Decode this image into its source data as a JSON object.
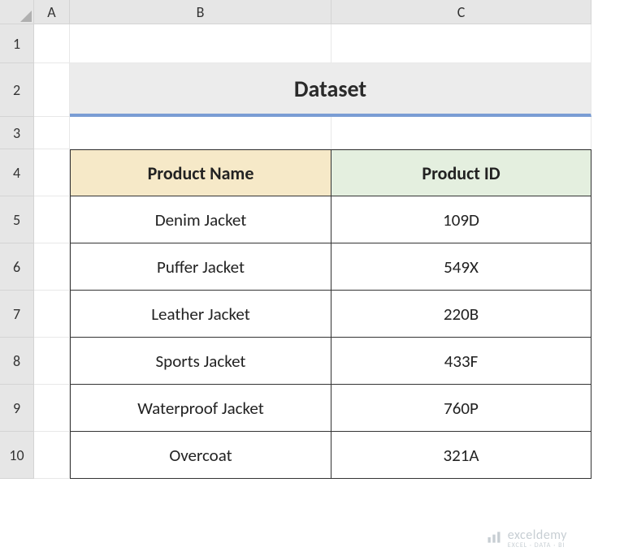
{
  "columns": [
    "A",
    "B",
    "C"
  ],
  "rows": [
    "1",
    "2",
    "3",
    "4",
    "5",
    "6",
    "7",
    "8",
    "9",
    "10"
  ],
  "title": "Dataset",
  "headers": {
    "b": "Product Name",
    "c": "Product ID"
  },
  "data": [
    {
      "name": "Denim Jacket",
      "id": "109D"
    },
    {
      "name": "Puffer Jacket",
      "id": "549X"
    },
    {
      "name": "Leather Jacket",
      "id": "220B"
    },
    {
      "name": "Sports Jacket",
      "id": "433F"
    },
    {
      "name": "Waterproof Jacket",
      "id": "760P"
    },
    {
      "name": "Overcoat",
      "id": "321A"
    }
  ],
  "watermark": {
    "main": "exceldemy",
    "sub": "EXCEL · DATA · BI"
  }
}
